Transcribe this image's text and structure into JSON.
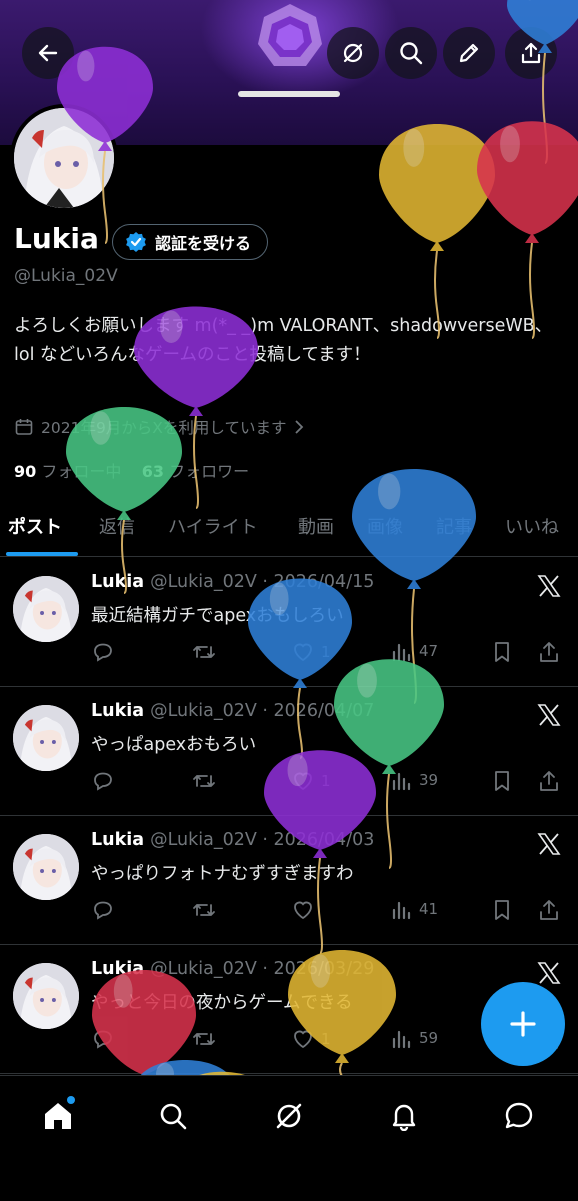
{
  "header": {
    "back_icon": "arrow-left-icon",
    "actions": [
      "grok-icon",
      "search-icon",
      "edit-icon",
      "share-icon"
    ],
    "banner_colors": [
      "#3b1a6e",
      "#1c0b3d"
    ]
  },
  "profile": {
    "name": "Lukia",
    "verify_label": "認証を受ける",
    "handle": "@Lukia_02V",
    "bio": "よろしくお願いします m(*_ _)m VALORANT、shadowverseWB、lol などいろんなゲームのこと投稿してます！",
    "joined": "2021年9月からXを利用しています",
    "following_count": "90",
    "following_label": "フォロー中",
    "followers_count": "63",
    "followers_label": "フォロワー"
  },
  "tabs": [
    "ポスト",
    "返信",
    "ハイライト",
    "動画",
    "画像",
    "記事",
    "いいね"
  ],
  "active_tab": "ポスト",
  "posts": [
    {
      "name": "Lukia",
      "meta": "@Lukia_02V · 2026/04/15",
      "text": "最近結構ガチでapexおもしろい",
      "likes": "1",
      "views": "47"
    },
    {
      "name": "Lukia",
      "meta": "@Lukia_02V · 2026/04/07",
      "text": "やっぱapexおもろい",
      "likes": "1",
      "views": "39"
    },
    {
      "name": "Lukia",
      "meta": "@Lukia_02V · 2026/04/03",
      "text": "やっぱりフォトナむずすぎますわ",
      "likes": "",
      "views": "41"
    },
    {
      "name": "Lukia",
      "meta": "@Lukia_02V · 2026/03/29",
      "text": "やっと今日の夜からゲームできる",
      "likes": "1",
      "views": "59"
    }
  ],
  "bottom_nav": [
    "home-icon",
    "search-icon",
    "grok-icon",
    "notifications-icon",
    "messages-icon"
  ],
  "colors": {
    "accent": "#1d9bf0",
    "text_secondary": "#71767b",
    "divider": "#2f3336"
  },
  "balloon_colors": {
    "purple": "#8e2fd6",
    "blue": "#2f80d8",
    "yellow": "#e2b733",
    "red": "#d8334d",
    "green": "#48c784"
  }
}
